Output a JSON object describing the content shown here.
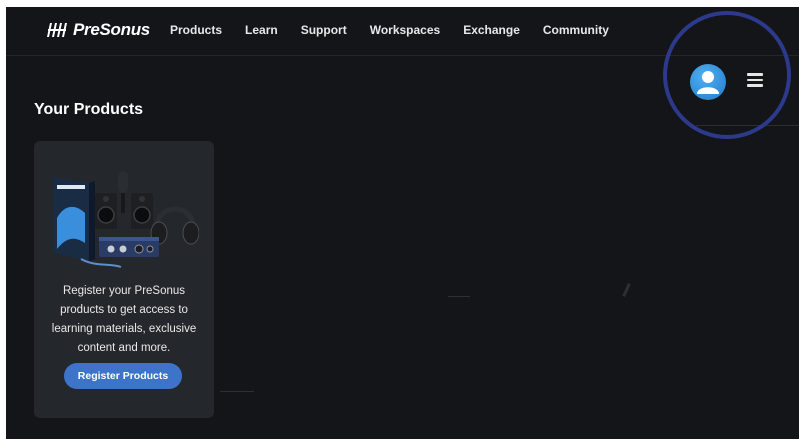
{
  "brand": {
    "name": "PreSonus"
  },
  "nav": {
    "items": [
      {
        "label": "Products"
      },
      {
        "label": "Learn"
      },
      {
        "label": "Support"
      },
      {
        "label": "Workspaces"
      },
      {
        "label": "Exchange"
      },
      {
        "label": "Community"
      }
    ]
  },
  "header_actions": {
    "avatar_icon": "user-avatar-icon",
    "menu_icon": "hamburger-menu-icon"
  },
  "main": {
    "section_title": "Your Products",
    "register_card": {
      "image": "presonus-product-bundle",
      "description": "Register your PreSonus products to get access to learning materials, exclusive content and more.",
      "button_label": "Register Products"
    }
  },
  "colors": {
    "background": "#131518",
    "card": "#24272c",
    "accent_button": "#3d73c8",
    "avatar": "#2e8ad8",
    "highlight_ring": "#2d3a8c"
  }
}
